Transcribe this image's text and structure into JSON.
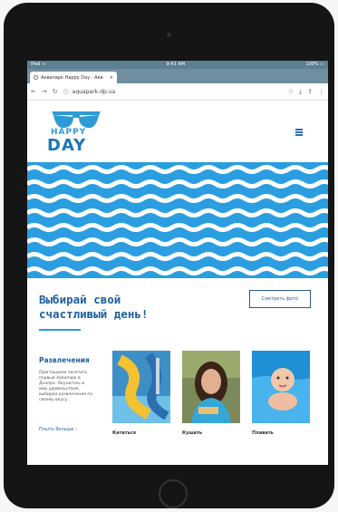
{
  "browser": {
    "status_left": "iPad ≈",
    "status_center": "9:41 AM",
    "status_right": "100% ▭",
    "tab_title": "Аквапарк Happy Day - Акв",
    "url": "aquapark-dp.ua"
  },
  "site": {
    "logo_line1": "HAPPY",
    "logo_line2": "DAY",
    "hero_title_line1": "Выбирай свой",
    "hero_title_line2": "счастливый день!",
    "photos_button": "Смотреть фото"
  },
  "fun": {
    "title": "Развлечения",
    "desc": "Приглашаем посетить первый Аквапарк в Днепре. Окунитесь в мир удовольствия, выбирая развлечения по своему вкусу.",
    "link": "Плыть больше ›",
    "cards": [
      {
        "caption": "Кататься"
      },
      {
        "caption": "Кушать"
      },
      {
        "caption": "Плавать"
      }
    ]
  },
  "colors": {
    "brand_blue": "#1d5fa0",
    "wave_blue": "#2a9ee0"
  }
}
